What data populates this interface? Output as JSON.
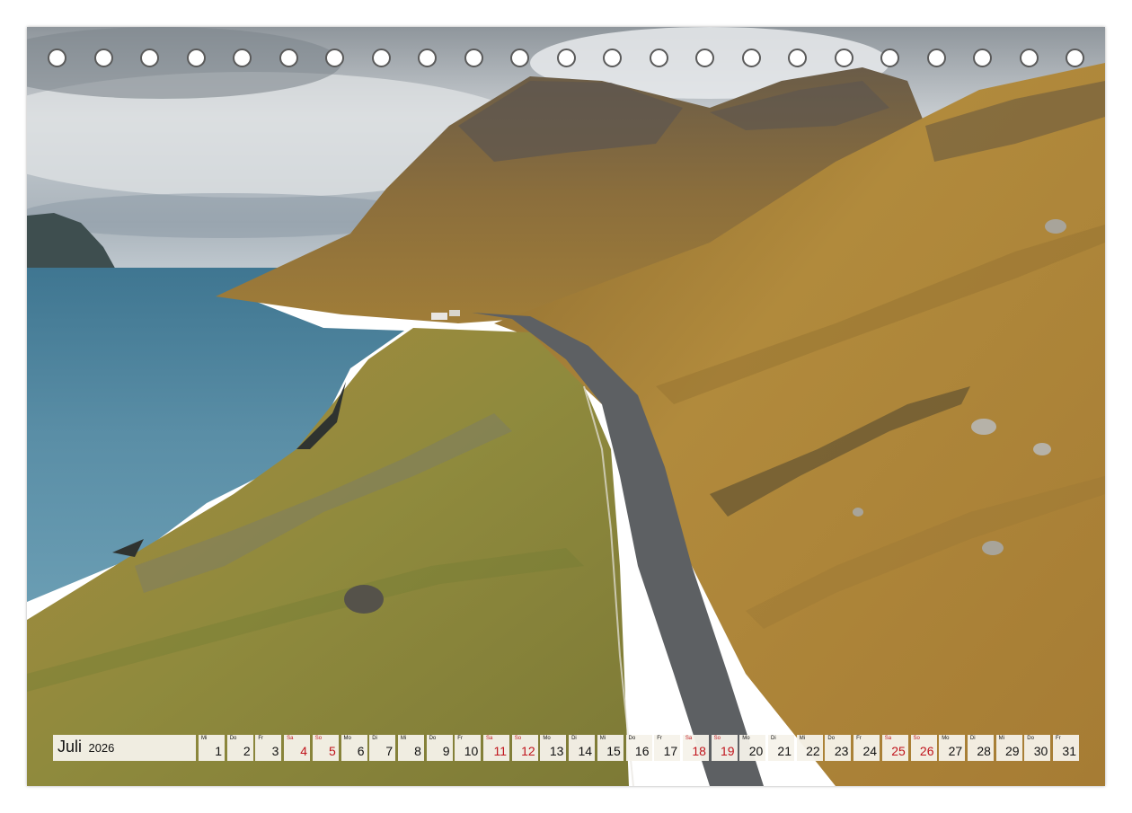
{
  "calendar": {
    "month": "Juli",
    "year": "2026",
    "days": [
      {
        "wd": "Mi",
        "num": "1",
        "red": false
      },
      {
        "wd": "Do",
        "num": "2",
        "red": false
      },
      {
        "wd": "Fr",
        "num": "3",
        "red": false
      },
      {
        "wd": "Sa",
        "num": "4",
        "red": true
      },
      {
        "wd": "So",
        "num": "5",
        "red": true
      },
      {
        "wd": "Mo",
        "num": "6",
        "red": false
      },
      {
        "wd": "Di",
        "num": "7",
        "red": false
      },
      {
        "wd": "Mi",
        "num": "8",
        "red": false
      },
      {
        "wd": "Do",
        "num": "9",
        "red": false
      },
      {
        "wd": "Fr",
        "num": "10",
        "red": false
      },
      {
        "wd": "Sa",
        "num": "11",
        "red": true
      },
      {
        "wd": "So",
        "num": "12",
        "red": true
      },
      {
        "wd": "Mo",
        "num": "13",
        "red": false
      },
      {
        "wd": "Di",
        "num": "14",
        "red": false
      },
      {
        "wd": "Mi",
        "num": "15",
        "red": false
      },
      {
        "wd": "Do",
        "num": "16",
        "red": false
      },
      {
        "wd": "Fr",
        "num": "17",
        "red": false
      },
      {
        "wd": "Sa",
        "num": "18",
        "red": true
      },
      {
        "wd": "So",
        "num": "19",
        "red": true
      },
      {
        "wd": "Mo",
        "num": "20",
        "red": false
      },
      {
        "wd": "Di",
        "num": "21",
        "red": false
      },
      {
        "wd": "Mi",
        "num": "22",
        "red": false
      },
      {
        "wd": "Do",
        "num": "23",
        "red": false
      },
      {
        "wd": "Fr",
        "num": "24",
        "red": false
      },
      {
        "wd": "Sa",
        "num": "25",
        "red": true
      },
      {
        "wd": "So",
        "num": "26",
        "red": true
      },
      {
        "wd": "Mo",
        "num": "27",
        "red": false
      },
      {
        "wd": "Di",
        "num": "28",
        "red": false
      },
      {
        "wd": "Mi",
        "num": "29",
        "red": false
      },
      {
        "wd": "Do",
        "num": "30",
        "red": false
      },
      {
        "wd": "Fr",
        "num": "31",
        "red": false
      }
    ]
  },
  "colors": {
    "weekend": "#c0141c",
    "sea": "#4a7f96",
    "grass": "#b08a3a",
    "road": "#5d6063",
    "sky": "#cfd3d6"
  },
  "binding_holes": 23
}
